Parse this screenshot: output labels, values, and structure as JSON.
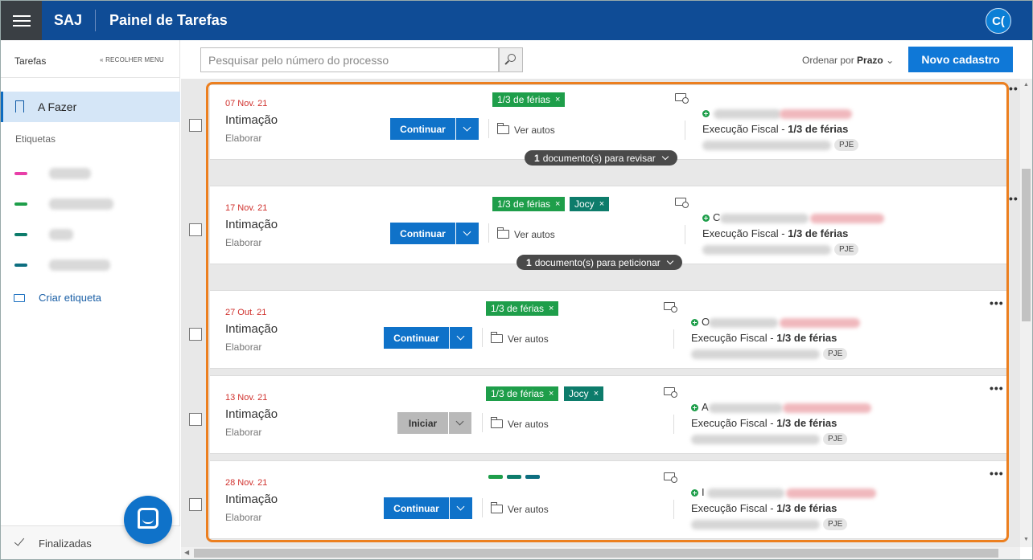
{
  "header": {
    "menu_icon": "hamburger-icon",
    "brand": "SAJ",
    "title": "Painel de Tarefas",
    "avatar_initials": "C("
  },
  "sidebar": {
    "title": "Tarefas",
    "collapse_label": "RECOLHER MENU",
    "active_item": "A Fazer",
    "section_label": "Etiquetas",
    "tags": [
      {
        "color": "#e83fa8"
      },
      {
        "color": "#1e9e4a"
      },
      {
        "color": "#0d7c6b"
      },
      {
        "color": "#0d6e80"
      }
    ],
    "create_tag_label": "Criar etiqueta",
    "finished_label": "Finalizadas"
  },
  "toolbar": {
    "search_placeholder": "Pesquisar pelo número do processo",
    "order_label": "Ordenar por",
    "order_value": "Prazo",
    "new_button": "Novo cadastro"
  },
  "tasks": [
    {
      "date": "07 Nov. 21",
      "type": "Intimação",
      "subtype": "Elaborar",
      "action": "Continuar",
      "tags": [
        {
          "label": "1/3 de férias",
          "color": "#1e9e4a"
        }
      ],
      "autos_label": "Ver autos",
      "process_class": "Execução Fiscal - ",
      "process_subject": "1/3 de férias",
      "system": "PJE",
      "doc_pill": {
        "count": "1",
        "text": "documento(s) para revisar"
      }
    },
    {
      "date": "17 Nov. 21",
      "type": "Intimação",
      "subtype": "Elaborar",
      "action": "Continuar",
      "tags": [
        {
          "label": "1/3 de férias",
          "color": "#1e9e4a"
        },
        {
          "label": "Jocy",
          "color": "#0d7c6b"
        }
      ],
      "autos_label": "Ver autos",
      "process_class": "Execução Fiscal - ",
      "process_subject": "1/3 de férias",
      "system": "PJE",
      "party_initial": "C",
      "doc_pill": {
        "count": "1",
        "text": "documento(s) para peticionar"
      }
    },
    {
      "date": "27 Out. 21",
      "type": "Intimação",
      "subtype": "Elaborar",
      "action": "Continuar",
      "tags": [
        {
          "label": "1/3 de férias",
          "color": "#1e9e4a"
        }
      ],
      "autos_label": "Ver autos",
      "process_class": "Execução Fiscal - ",
      "process_subject": "1/3 de férias",
      "system": "PJE",
      "party_initial": "O"
    },
    {
      "date": "13 Nov. 21",
      "type": "Intimação",
      "subtype": "Elaborar",
      "action": "Iniciar",
      "tags": [
        {
          "label": "1/3 de férias",
          "color": "#1e9e4a"
        },
        {
          "label": "Jocy",
          "color": "#0d7c6b"
        }
      ],
      "autos_label": "Ver autos",
      "process_class": "Execução Fiscal - ",
      "process_subject": "1/3 de férias",
      "system": "PJE",
      "party_initial": "A"
    },
    {
      "date": "28 Nov. 21",
      "type": "Intimação",
      "subtype": "Elaborar",
      "action": "Continuar",
      "tags": [],
      "tag_colors": [
        "#1e9e4a",
        "#0d7c6b",
        "#0d6e80"
      ],
      "autos_label": "Ver autos",
      "process_class": "Execução Fiscal - ",
      "process_subject": "1/3 de férias",
      "system": "PJE",
      "party_initial": "I"
    }
  ]
}
